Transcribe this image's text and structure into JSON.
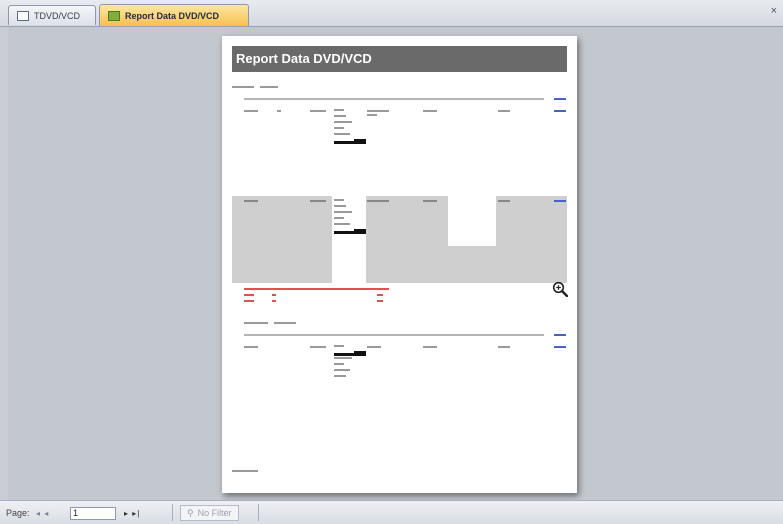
{
  "tabs": [
    {
      "label": "TDVD/VCD",
      "icon": "table-icon",
      "active": false
    },
    {
      "label": "Report Data DVD/VCD",
      "icon": "report-icon",
      "active": true
    }
  ],
  "close_glyph": "×",
  "report": {
    "title": "Report Data DVD/VCD"
  },
  "statusbar": {
    "page_label": "Page:",
    "page_value": "1",
    "nav_prev": "◂ ◂",
    "nav_next": "▸ ▸|",
    "filter_label": "No Filter"
  },
  "colors": {
    "active_tab": "#f7c04e",
    "title_bar": "#6a6a6a",
    "link": "#4a60c8",
    "highlight_red": "#e05050"
  }
}
